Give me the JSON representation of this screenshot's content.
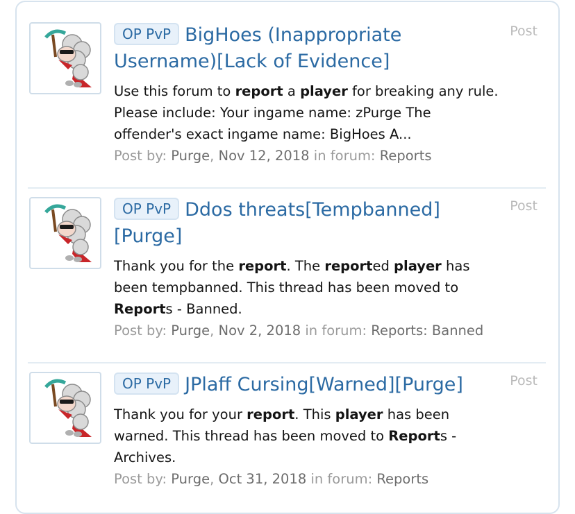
{
  "results": [
    {
      "prefix": "OP PvP",
      "title": "BigHoes (Inappropriate Username)[Lack of Evidence]",
      "snippet": [
        {
          "t": "Use this forum to ",
          "b": false
        },
        {
          "t": "report",
          "b": true
        },
        {
          "t": " a ",
          "b": false
        },
        {
          "t": "player",
          "b": true
        },
        {
          "t": " for breaking any rule. Please include: Your ingame name: zPurge The offender's exact ingame name: BigHoes A...",
          "b": false
        }
      ],
      "meta_prefix": "Post by: ",
      "author": "Purge",
      "date": "Nov 12, 2018",
      "forum_prefix": " in forum: ",
      "forum": "Reports",
      "type": "Post"
    },
    {
      "prefix": "OP PvP",
      "title": "Ddos threats[Tempbanned][Purge]",
      "snippet": [
        {
          "t": "Thank you for the ",
          "b": false
        },
        {
          "t": "report",
          "b": true
        },
        {
          "t": ". The ",
          "b": false
        },
        {
          "t": "report",
          "b": true
        },
        {
          "t": "ed ",
          "b": false
        },
        {
          "t": "player",
          "b": true
        },
        {
          "t": " has been tempbanned. This thread has been moved to ",
          "b": false
        },
        {
          "t": "Report",
          "b": true
        },
        {
          "t": "s - Banned.",
          "b": false
        }
      ],
      "meta_prefix": "Post by: ",
      "author": "Purge",
      "date": "Nov 2, 2018",
      "forum_prefix": " in forum: ",
      "forum": "Reports: Banned",
      "type": "Post"
    },
    {
      "prefix": "OP PvP",
      "title": "JPlaff Cursing[Warned][Purge]",
      "snippet": [
        {
          "t": "Thank you for your ",
          "b": false
        },
        {
          "t": "report",
          "b": true
        },
        {
          "t": ". This ",
          "b": false
        },
        {
          "t": "player",
          "b": true
        },
        {
          "t": " has been warned. This thread has been moved to ",
          "b": false
        },
        {
          "t": "Report",
          "b": true
        },
        {
          "t": "s - Archives.",
          "b": false
        }
      ],
      "meta_prefix": "Post by: ",
      "author": "Purge",
      "date": "Oct 31, 2018",
      "forum_prefix": " in forum: ",
      "forum": "Reports",
      "type": "Post"
    }
  ],
  "avatar_icon": "sheep-with-pickaxe-avatar",
  "colors": {
    "link": "#2b6aa3",
    "prefix_bg": "#e8f1fa",
    "meta": "#9a9a9a",
    "border": "#d7e3ee"
  }
}
